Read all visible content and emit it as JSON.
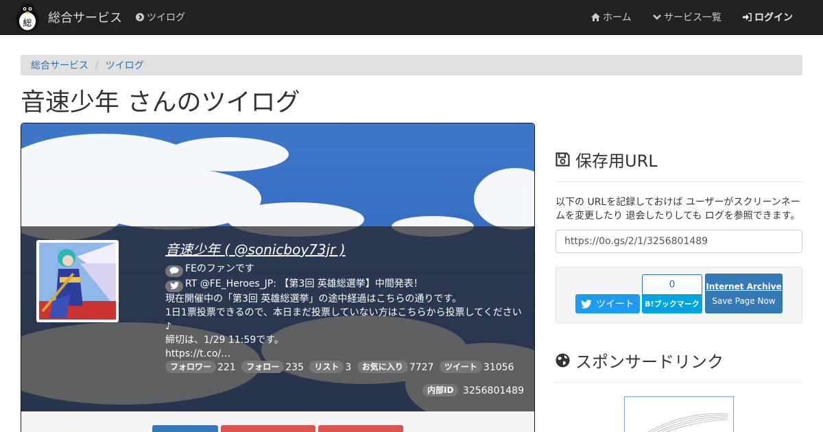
{
  "navbar": {
    "brand": "総合サービス",
    "brand_logo_char": "総",
    "nav_twilog": "ツイログ",
    "nav_home": "ホーム",
    "nav_services": "サービス一覧",
    "nav_login": "ログイン",
    "color": "#222222"
  },
  "breadcrumb": {
    "items": [
      "総合サービス",
      "ツイログ"
    ],
    "separator": "/"
  },
  "page_title": "音速少年 さんのツイログ",
  "profile": {
    "name_line": "音速少年 ( @sonicboy73jr )",
    "bio": "FEのファンです",
    "latest_tweet_head": "RT @FE_Heroes_JP: 【第3回 英雄総選挙】中間発表！",
    "latest_tweet_body": [
      "現在開催中の「第3回 英雄総選挙」の途中経過はこちらの通りです。",
      "1日1票投票できるので、本日まだ投票していない方はこちらから投票してください♪",
      "締切は、1/29 11:59です。",
      "https://t.co/…"
    ],
    "stats": [
      {
        "label": "フォロワー",
        "value": "221"
      },
      {
        "label": "フォロー",
        "value": "235"
      },
      {
        "label": "リスト",
        "value": "3"
      },
      {
        "label": "お気に入り",
        "value": "7727"
      },
      {
        "label": "ツイート",
        "value": "31056"
      }
    ],
    "internal_id_label": "内部ID",
    "internal_id": "3256801489"
  },
  "sidebar": {
    "save_heading": "保存用URL",
    "save_description": "以下の URLを記録しておけば ユーザーがスクリーンネームを変更したり 退会したりしても ログを参照できます。",
    "save_url": "https://0o.gs/2/1/3256801489",
    "tweet_button": "ツイート",
    "hatena_count": "0",
    "hatena_button": "B!ブックマーク",
    "ia_title": "Internet Archive",
    "ia_subtitle": "Save Page Now",
    "sponsor_heading": "スポンサードリンク"
  },
  "colors": {
    "link": "#2a73b6",
    "primary": "#337ab7",
    "danger": "#d9534f",
    "twitter": "#1d9bf0",
    "hatena": "#00a4de"
  }
}
